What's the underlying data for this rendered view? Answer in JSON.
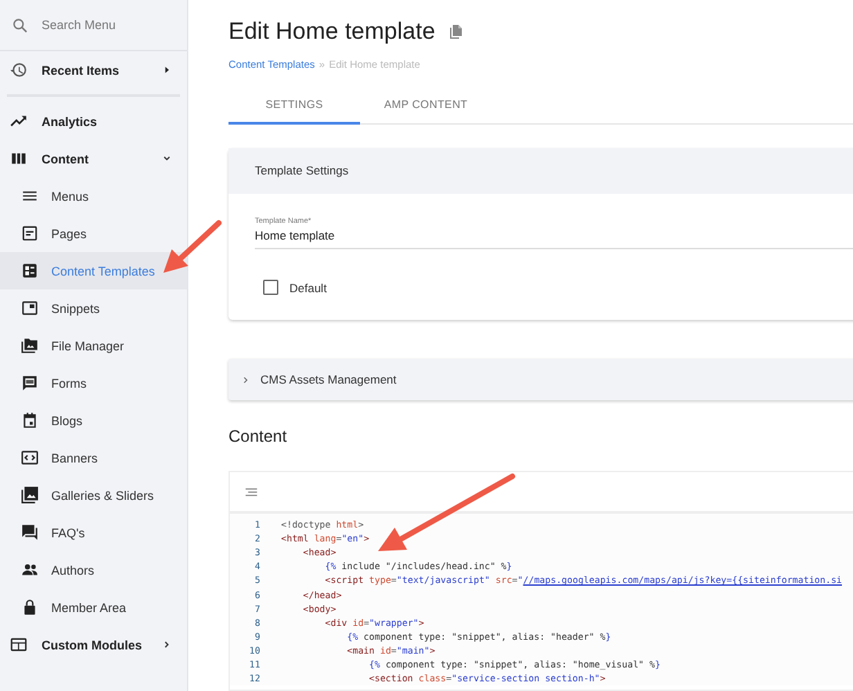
{
  "sidebar": {
    "search": {
      "placeholder": "Search Menu"
    },
    "items": [
      {
        "label": "Recent Items",
        "kind": "top",
        "expanded": false,
        "selected": false
      },
      {
        "label": "Analytics",
        "kind": "top",
        "selected": false
      },
      {
        "label": "Content",
        "kind": "top",
        "expanded": true,
        "selected": false
      },
      {
        "label": "Menus",
        "kind": "sub",
        "selected": false
      },
      {
        "label": "Pages",
        "kind": "sub",
        "selected": false
      },
      {
        "label": "Content Templates",
        "kind": "sub",
        "selected": true
      },
      {
        "label": "Snippets",
        "kind": "sub",
        "selected": false
      },
      {
        "label": "File Manager",
        "kind": "sub",
        "selected": false
      },
      {
        "label": "Forms",
        "kind": "sub",
        "selected": false
      },
      {
        "label": "Blogs",
        "kind": "sub",
        "selected": false
      },
      {
        "label": "Banners",
        "kind": "sub",
        "selected": false
      },
      {
        "label": "Galleries & Sliders",
        "kind": "sub",
        "selected": false
      },
      {
        "label": "FAQ's",
        "kind": "sub",
        "selected": false
      },
      {
        "label": "Authors",
        "kind": "sub",
        "selected": false
      },
      {
        "label": "Member Area",
        "kind": "sub",
        "selected": false
      },
      {
        "label": "Custom Modules",
        "kind": "top",
        "expanded": false,
        "selected": false
      }
    ]
  },
  "page": {
    "title": "Edit Home template",
    "breadcrumb": [
      "Content Templates",
      "Edit Home template"
    ],
    "breadcrumb_separator": "»",
    "tabs": [
      {
        "label": "SETTINGS",
        "selected": true
      },
      {
        "label": "AMP CONTENT",
        "selected": false
      }
    ],
    "settings_card": {
      "title": "Template Settings",
      "field": {
        "label": "Template Name*",
        "value": "Home template"
      },
      "checkbox": {
        "label": "Default",
        "checked": false
      }
    },
    "assets_panel": {
      "title": "CMS Assets Management",
      "expanded": false
    },
    "content_heading": "Content",
    "code": [
      {
        "number": "1",
        "tokens": [
          {
            "kind": "punct",
            "text": "<!doctype "
          },
          {
            "kind": "attr",
            "text": "html"
          },
          {
            "kind": "punct",
            "text": ">"
          }
        ]
      },
      {
        "number": "2",
        "tokens": [
          {
            "kind": "tag",
            "text": "<html "
          },
          {
            "kind": "attr",
            "text": "lang"
          },
          {
            "kind": "punct",
            "text": "="
          },
          {
            "kind": "string",
            "text": "\"en\""
          },
          {
            "kind": "tag",
            "text": ">"
          }
        ]
      },
      {
        "number": "3",
        "tokens": [
          {
            "kind": "tag",
            "text": "    <head>"
          }
        ]
      },
      {
        "number": "4",
        "tokens": [
          {
            "kind": "template",
            "text": "        {%"
          },
          {
            "kind": "plain",
            "text": " include \"/includes/head.inc\" %"
          },
          {
            "kind": "template",
            "text": "}"
          }
        ]
      },
      {
        "number": "5",
        "tokens": [
          {
            "kind": "tag",
            "text": "        <script "
          },
          {
            "kind": "attr",
            "text": "type"
          },
          {
            "kind": "punct",
            "text": "="
          },
          {
            "kind": "string",
            "text": "\"text/javascript\" "
          },
          {
            "kind": "attr",
            "text": "src"
          },
          {
            "kind": "punct",
            "text": "="
          },
          {
            "kind": "string",
            "text": "\""
          },
          {
            "kind": "link",
            "text": "//maps.googleapis.com/maps/api/js?key={{siteinformation.si"
          }
        ]
      },
      {
        "number": "6",
        "tokens": [
          {
            "kind": "tag",
            "text": "    </head>"
          }
        ]
      },
      {
        "number": "7",
        "tokens": [
          {
            "kind": "tag",
            "text": "    <body>"
          }
        ]
      },
      {
        "number": "8",
        "tokens": [
          {
            "kind": "tag",
            "text": "        <div "
          },
          {
            "kind": "attr",
            "text": "id"
          },
          {
            "kind": "punct",
            "text": "="
          },
          {
            "kind": "string",
            "text": "\"wrapper\""
          },
          {
            "kind": "tag",
            "text": ">"
          }
        ]
      },
      {
        "number": "9",
        "tokens": [
          {
            "kind": "template",
            "text": "            {%"
          },
          {
            "kind": "plain",
            "text": " component type: \"snippet\", alias: \"header\" %"
          },
          {
            "kind": "template",
            "text": "}"
          }
        ]
      },
      {
        "number": "10",
        "tokens": [
          {
            "kind": "tag",
            "text": "            <main "
          },
          {
            "kind": "attr",
            "text": "id"
          },
          {
            "kind": "punct",
            "text": "="
          },
          {
            "kind": "string",
            "text": "\"main\""
          },
          {
            "kind": "tag",
            "text": ">"
          }
        ]
      },
      {
        "number": "11",
        "tokens": [
          {
            "kind": "template",
            "text": "                {%"
          },
          {
            "kind": "plain",
            "text": " component type: \"snippet\", alias: \"home_visual\" %"
          },
          {
            "kind": "template",
            "text": "}"
          }
        ]
      },
      {
        "number": "12",
        "tokens": [
          {
            "kind": "tag",
            "text": "                <section "
          },
          {
            "kind": "attr",
            "text": "class"
          },
          {
            "kind": "punct",
            "text": "="
          },
          {
            "kind": "string",
            "text": "\"service-section section-h\""
          },
          {
            "kind": "tag",
            "text": ">"
          }
        ]
      }
    ]
  }
}
